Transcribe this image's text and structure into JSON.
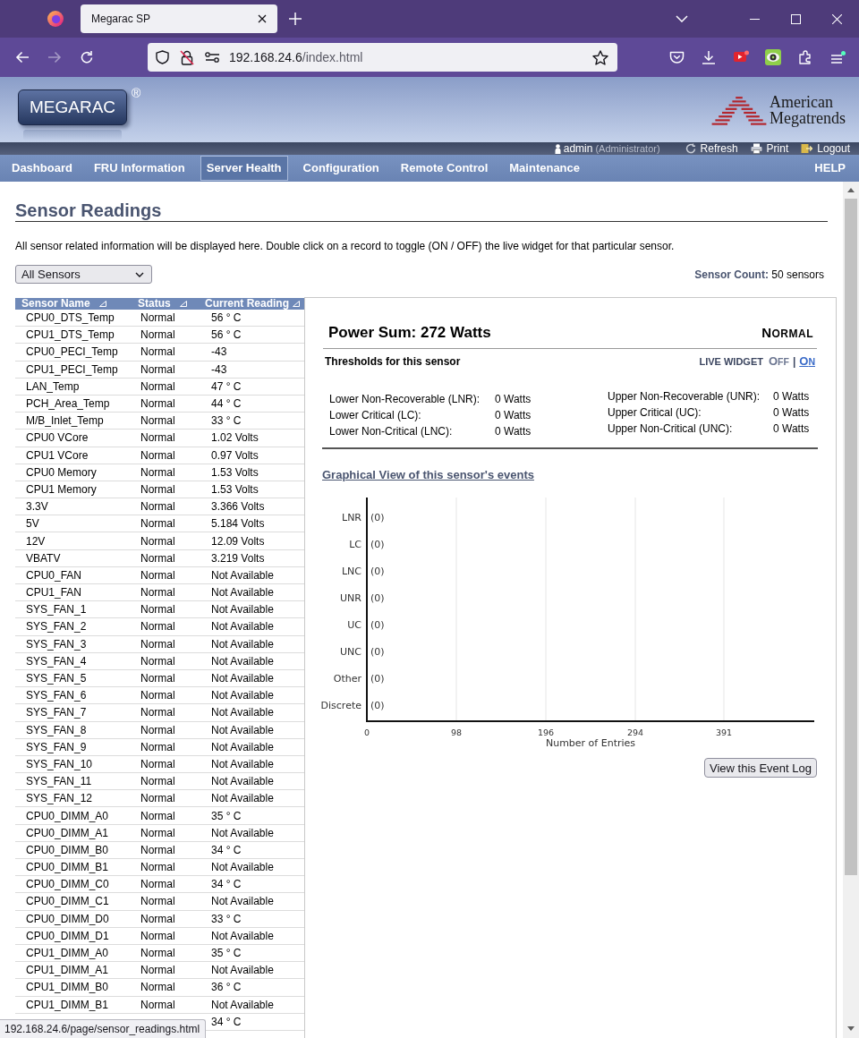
{
  "browser": {
    "tab_title": "Megarac SP",
    "url_host": "192.168.24.6",
    "url_path": "/index.html",
    "forward_disabled": true,
    "status_link": "192.168.24.6/page/sensor_readings.html"
  },
  "header": {
    "logo": "MEGARAC",
    "logo_mark": "®",
    "vendor_lines": [
      "American",
      "Megatrends"
    ],
    "user": "admin",
    "role": "(Administrator)",
    "actions": [
      {
        "kind": "refresh",
        "label": "Refresh"
      },
      {
        "kind": "print",
        "label": "Print"
      },
      {
        "kind": "logout",
        "label": "Logout"
      }
    ]
  },
  "nav": {
    "items": [
      {
        "label": "Dashboard",
        "selected": false
      },
      {
        "label": "FRU Information",
        "selected": false
      },
      {
        "label": "Server Health",
        "selected": true
      },
      {
        "label": "Configuration",
        "selected": false
      },
      {
        "label": "Remote Control",
        "selected": false
      },
      {
        "label": "Maintenance",
        "selected": false
      }
    ],
    "help": "HELP"
  },
  "page": {
    "title": "Sensor Readings",
    "description": "All sensor related information will be displayed here. Double click on a record to toggle (ON / OFF) the live widget for that particular sensor.",
    "filter": {
      "value": "All Sensors"
    },
    "sensor_count": "**Sensor Count:** 50 sensors"
  },
  "table": {
    "columns": [
      "Sensor Name",
      "Status",
      "Current Reading"
    ],
    "rows": [
      {
        "name": "CPU0_DTS_Temp",
        "status": "Normal",
        "reading": "56 ° C"
      },
      {
        "name": "CPU1_DTS_Temp",
        "status": "Normal",
        "reading": "56 ° C"
      },
      {
        "name": "CPU0_PECI_Temp",
        "status": "Normal",
        "reading": "-43"
      },
      {
        "name": "CPU1_PECI_Temp",
        "status": "Normal",
        "reading": "-43"
      },
      {
        "name": "LAN_Temp",
        "status": "Normal",
        "reading": "47 ° C"
      },
      {
        "name": "PCH_Area_Temp",
        "status": "Normal",
        "reading": "44 ° C"
      },
      {
        "name": "M/B_Inlet_Temp",
        "status": "Normal",
        "reading": "33 ° C"
      },
      {
        "name": "CPU0 VCore",
        "status": "Normal",
        "reading": "1.02 Volts"
      },
      {
        "name": "CPU1 VCore",
        "status": "Normal",
        "reading": "0.97 Volts"
      },
      {
        "name": "CPU0 Memory",
        "status": "Normal",
        "reading": "1.53 Volts"
      },
      {
        "name": "CPU1 Memory",
        "status": "Normal",
        "reading": "1.53 Volts"
      },
      {
        "name": "3.3V",
        "status": "Normal",
        "reading": "3.366 Volts"
      },
      {
        "name": "5V",
        "status": "Normal",
        "reading": "5.184 Volts"
      },
      {
        "name": "12V",
        "status": "Normal",
        "reading": "12.09 Volts"
      },
      {
        "name": "VBATV",
        "status": "Normal",
        "reading": "3.219 Volts"
      },
      {
        "name": "CPU0_FAN",
        "status": "Normal",
        "reading": "Not Available"
      },
      {
        "name": "CPU1_FAN",
        "status": "Normal",
        "reading": "Not Available"
      },
      {
        "name": "SYS_FAN_1",
        "status": "Normal",
        "reading": "Not Available"
      },
      {
        "name": "SYS_FAN_2",
        "status": "Normal",
        "reading": "Not Available"
      },
      {
        "name": "SYS_FAN_3",
        "status": "Normal",
        "reading": "Not Available"
      },
      {
        "name": "SYS_FAN_4",
        "status": "Normal",
        "reading": "Not Available"
      },
      {
        "name": "SYS_FAN_5",
        "status": "Normal",
        "reading": "Not Available"
      },
      {
        "name": "SYS_FAN_6",
        "status": "Normal",
        "reading": "Not Available"
      },
      {
        "name": "SYS_FAN_7",
        "status": "Normal",
        "reading": "Not Available"
      },
      {
        "name": "SYS_FAN_8",
        "status": "Normal",
        "reading": "Not Available"
      },
      {
        "name": "SYS_FAN_9",
        "status": "Normal",
        "reading": "Not Available"
      },
      {
        "name": "SYS_FAN_10",
        "status": "Normal",
        "reading": "Not Available"
      },
      {
        "name": "SYS_FAN_11",
        "status": "Normal",
        "reading": "Not Available"
      },
      {
        "name": "SYS_FAN_12",
        "status": "Normal",
        "reading": "Not Available"
      },
      {
        "name": "CPU0_DIMM_A0",
        "status": "Normal",
        "reading": "35 ° C"
      },
      {
        "name": "CPU0_DIMM_A1",
        "status": "Normal",
        "reading": "Not Available"
      },
      {
        "name": "CPU0_DIMM_B0",
        "status": "Normal",
        "reading": "34 ° C"
      },
      {
        "name": "CPU0_DIMM_B1",
        "status": "Normal",
        "reading": "Not Available"
      },
      {
        "name": "CPU0_DIMM_C0",
        "status": "Normal",
        "reading": "34 ° C"
      },
      {
        "name": "CPU0_DIMM_C1",
        "status": "Normal",
        "reading": "Not Available"
      },
      {
        "name": "CPU0_DIMM_D0",
        "status": "Normal",
        "reading": "33 ° C"
      },
      {
        "name": "CPU0_DIMM_D1",
        "status": "Normal",
        "reading": "Not Available"
      },
      {
        "name": "CPU1_DIMM_A0",
        "status": "Normal",
        "reading": "35 ° C"
      },
      {
        "name": "CPU1_DIMM_A1",
        "status": "Normal",
        "reading": "Not Available"
      },
      {
        "name": "CPU1_DIMM_B0",
        "status": "Normal",
        "reading": "36 ° C"
      },
      {
        "name": "CPU1_DIMM_B1",
        "status": "Normal",
        "reading": "Not Available"
      },
      {
        "reading": "34 ° C"
      }
    ]
  },
  "detail": {
    "title": "Power Sum: 272 Watts",
    "state": "NORMAL",
    "thresholds_title": "Thresholds for this sensor",
    "live_widget": {
      "label": "LIVE WIDGET",
      "separator": "|",
      "options": [
        {
          "label": "OFF",
          "selected": false
        },
        {
          "label": "ON",
          "selected": true
        }
      ]
    },
    "lower": [
      {
        "label": "Lower Non-Recoverable (LNR):",
        "value": "0 Watts"
      },
      {
        "label": "Lower Critical (LC):",
        "value": "0 Watts"
      },
      {
        "label": "Lower Non-Critical (LNC):",
        "value": "0 Watts"
      }
    ],
    "upper": [
      {
        "label": "Upper Non-Recoverable (UNR):",
        "value": "0 Watts"
      },
      {
        "label": "Upper Critical (UC):",
        "value": "0 Watts"
      },
      {
        "label": "Upper Non-Critical (UNC):",
        "value": "0 Watts"
      }
    ],
    "events_link": "Graphical View of this sensor's events",
    "chart_data": {
      "type": "bar",
      "orientation": "horizontal",
      "grid": true,
      "xlabel": "Number of Entries",
      "categories": [
        "LNR",
        "LC",
        "LNC",
        "UNR",
        "UC",
        "UNC",
        "Other",
        "Discrete"
      ],
      "values": [
        0,
        0,
        0,
        0,
        0,
        0,
        0,
        0
      ],
      "value_labels": [
        "(0)",
        "(0)",
        "(0)",
        "(0)",
        "(0)",
        "(0)",
        "(0)",
        "(0)"
      ],
      "xlim": [
        0,
        490
      ],
      "xticks": [
        0,
        98,
        196,
        294,
        391
      ]
    },
    "button": "View this Event Log"
  }
}
